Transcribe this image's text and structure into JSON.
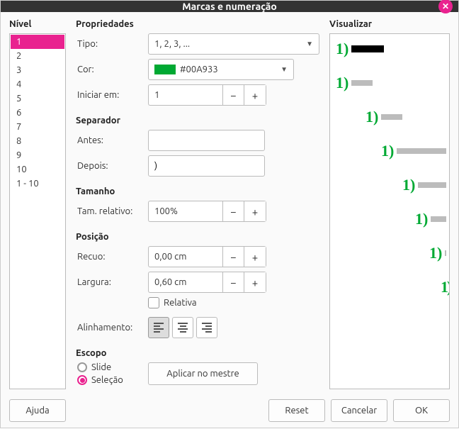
{
  "title": "Marcas e numeração",
  "headers": {
    "level": "Nível",
    "props": "Propriedades",
    "preview": "Visualizar"
  },
  "levels": [
    "1",
    "2",
    "3",
    "4",
    "5",
    "6",
    "7",
    "8",
    "9",
    "10",
    "1 - 10"
  ],
  "selected_level_index": 0,
  "props": {
    "type_label": "Tipo:",
    "type_value": "1, 2, 3, ...",
    "color_label": "Cor:",
    "color_value": "#00A933",
    "start_label": "Iniciar em:",
    "start_value": "1"
  },
  "separator": {
    "header": "Separador",
    "before_label": "Antes:",
    "before_value": "",
    "after_label": "Depois:",
    "after_value": ")"
  },
  "size": {
    "header": "Tamanho",
    "rel_label": "Tam. relativo:",
    "rel_value": "100%"
  },
  "position": {
    "header": "Posição",
    "indent_label": "Recuo:",
    "indent_value": "0,00 cm",
    "width_label": "Largura:",
    "width_value": "0,60 cm",
    "relative_label": "Relativa",
    "align_label": "Alinhamento:"
  },
  "scope": {
    "header": "Escopo",
    "slide": "Slide",
    "selection": "Seleção",
    "apply_master": "Aplicar no mestre"
  },
  "footer": {
    "help": "Ajuda",
    "reset": "Reset",
    "cancel": "Cancelar",
    "ok": "OK"
  },
  "preview_number": "1)"
}
